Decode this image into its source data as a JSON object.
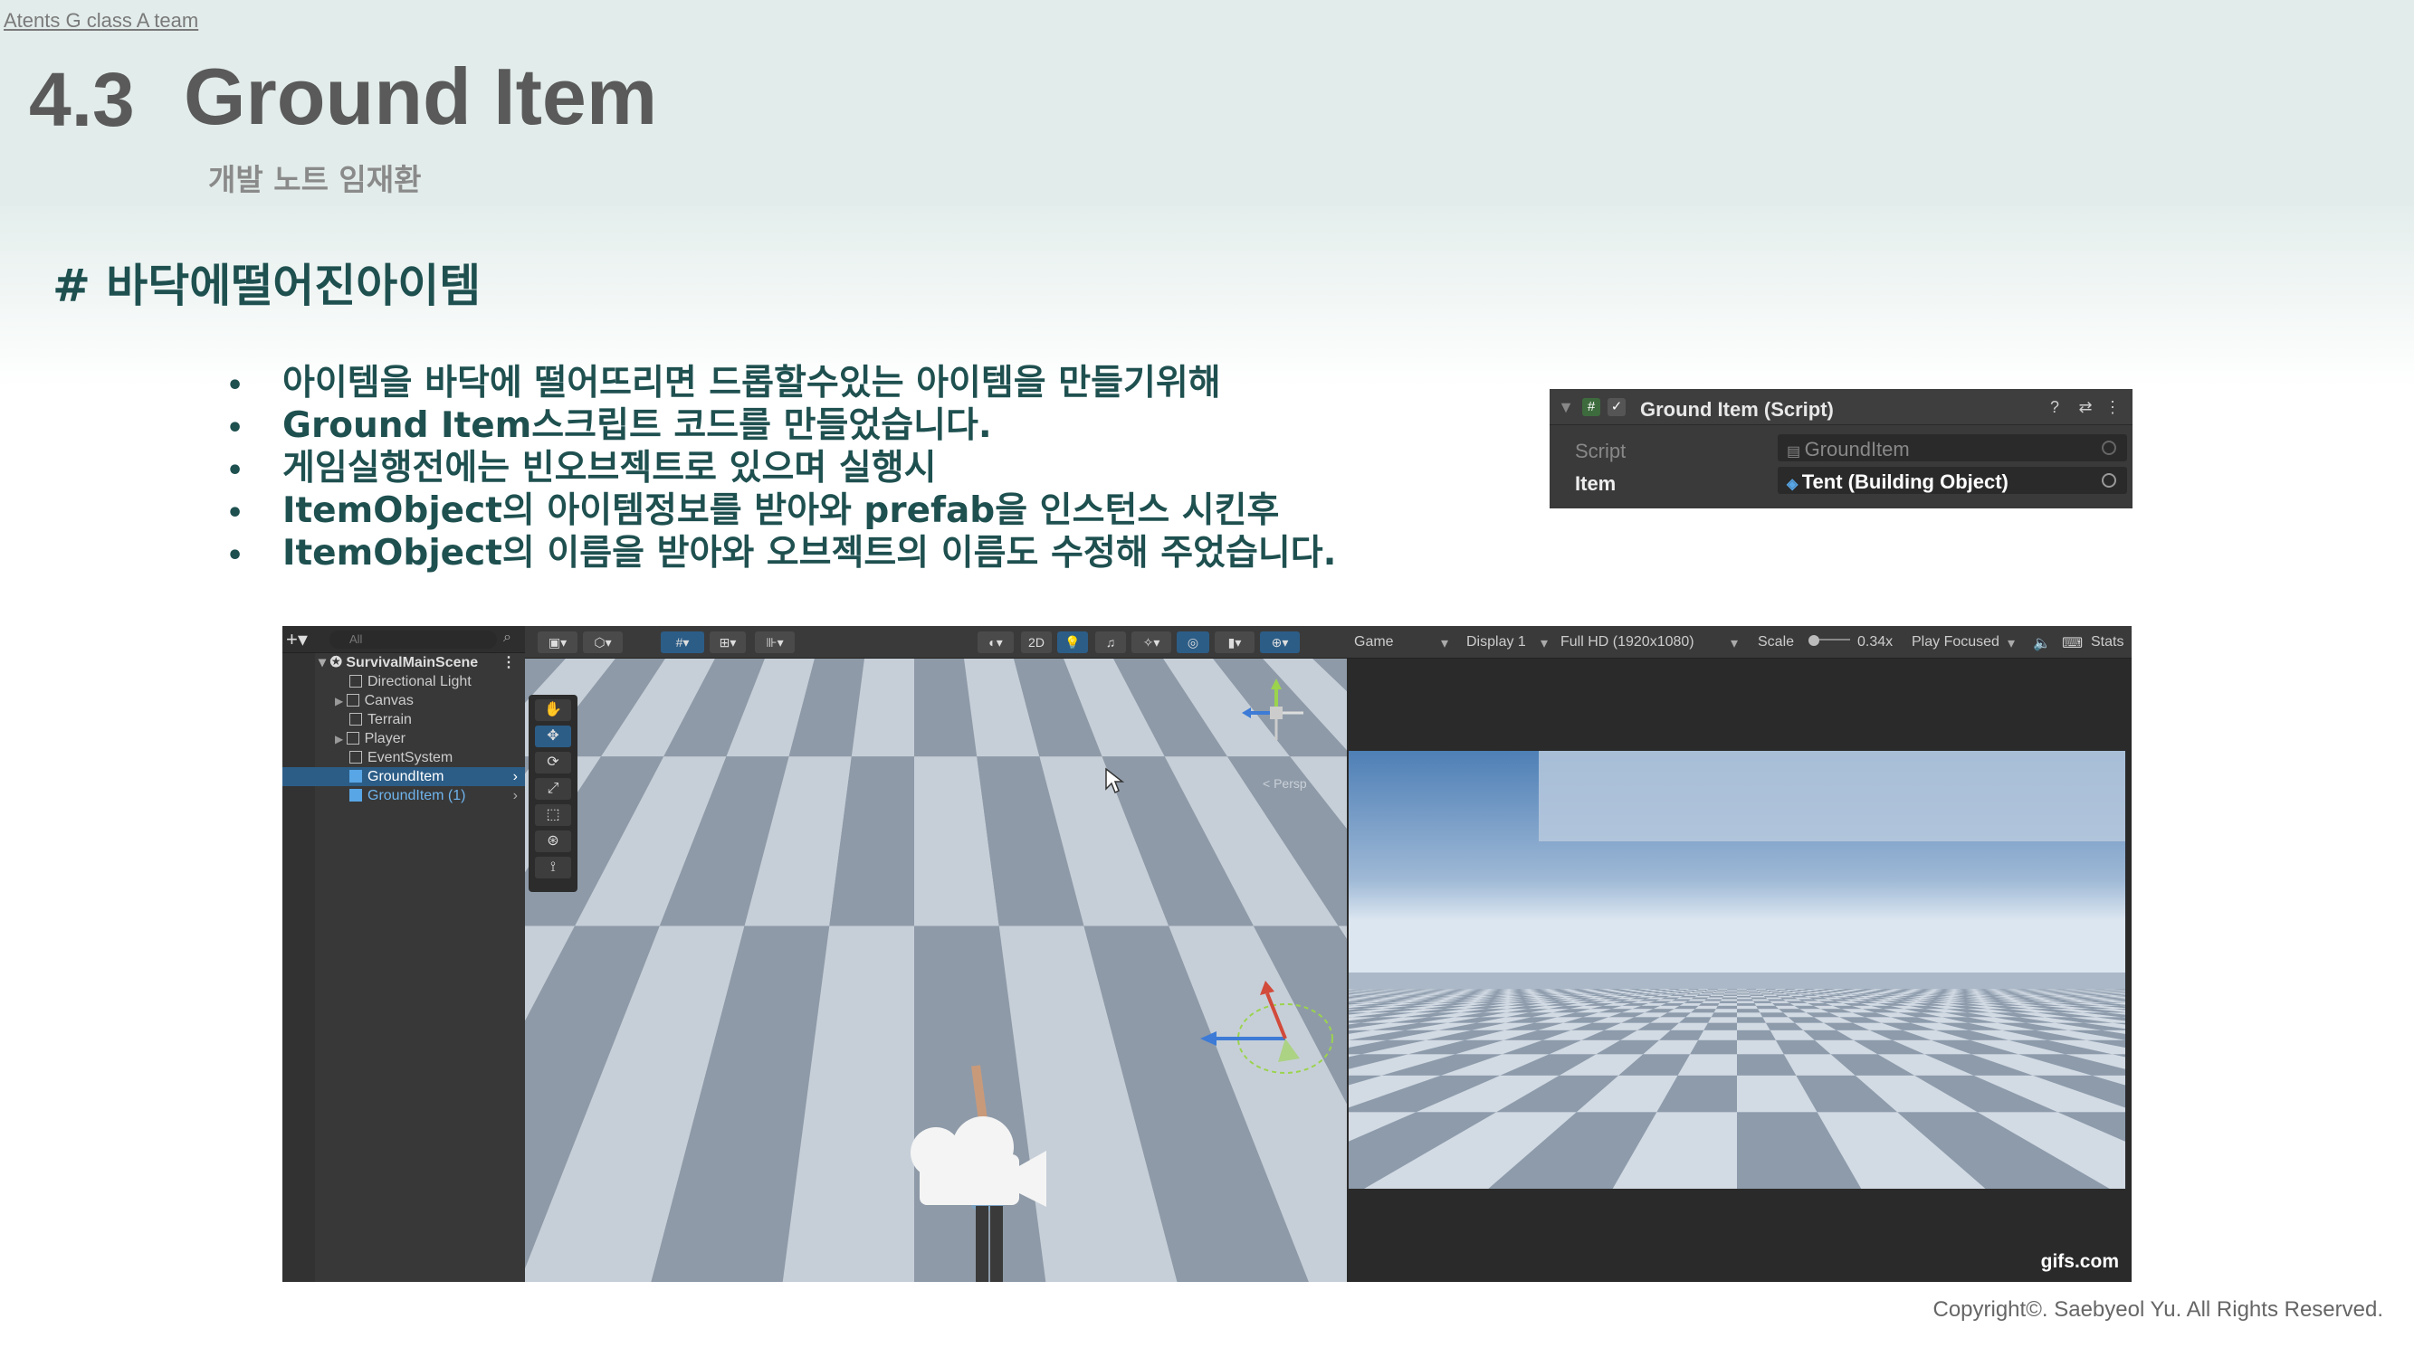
{
  "slide": {
    "team": "Atents G class A team",
    "section_number": "4.3",
    "section_title": "Ground Item",
    "subtitle": "개발 노트 임재환",
    "heading": "# 바닥에떨어진아이템",
    "bullets": [
      "아이템을 바닥에 떨어뜨리면 드롭할수있는 아이템을 만들기위해",
      "Ground Item스크립트 코드를 만들었습니다.",
      "게임실행전에는 빈오브젝트로 있으며 실행시",
      "ItemObject의 아이템정보를 받아와 prefab을 인스턴스 시킨후",
      "ItemObject의 이름을 받아와 오브젝트의 이름도 수정해 주었습니다."
    ],
    "copyright": "Copyright©. Saebyeol Yu. All Rights Reserved."
  },
  "inspector": {
    "component_title": "Ground Item (Script)",
    "script_label": "Script",
    "script_value": "GroundItem",
    "item_label": "Item",
    "item_value": "Tent (Building Object)"
  },
  "hierarchy": {
    "search_placeholder": "All",
    "scene_name": "SurvivalMainScene",
    "items": [
      "Directional Light",
      "Canvas",
      "Terrain",
      "Player",
      "EventSystem",
      "GroundItem",
      "GroundItem (1)"
    ]
  },
  "scene_toolbar": {
    "mode_2d": "2D",
    "persp_label": "< Persp"
  },
  "game_toolbar": {
    "game_tab": "Game",
    "display": "Display 1",
    "resolution": "Full HD (1920x1080)",
    "scale_label": "Scale",
    "scale_value": "0.34x",
    "play_mode": "Play Focused",
    "stats": "Stats"
  },
  "watermark": "gifs.com",
  "colors": {
    "header_bg": "#e2ecea",
    "heading_text": "#1f5050",
    "title_text": "#5a5a5a",
    "selection_blue": "#2c5d87"
  }
}
